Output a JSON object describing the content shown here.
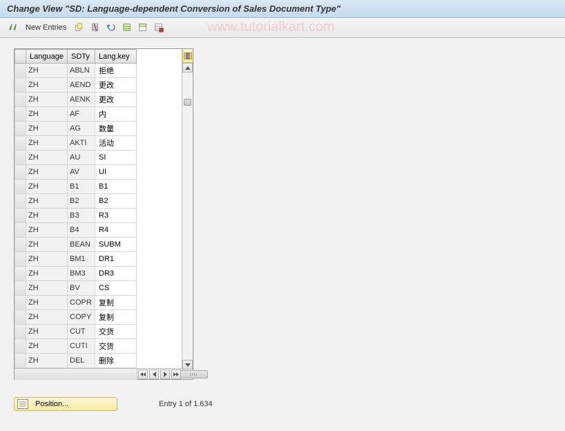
{
  "title": "Change View \"SD: Language-dependent Conversion of Sales Document Type\"",
  "watermark": "www.tutorialkart.com",
  "toolbar": {
    "new_entries": "New Entries"
  },
  "grid": {
    "headers": {
      "language": "Language",
      "sdty": "SDTy",
      "langkey": "Lang.key"
    },
    "rows": [
      {
        "lang": "ZH",
        "sdty": "ABLN",
        "langkey": "拒绝"
      },
      {
        "lang": "ZH",
        "sdty": "AEND",
        "langkey": "更改"
      },
      {
        "lang": "ZH",
        "sdty": "AENK",
        "langkey": "更改"
      },
      {
        "lang": "ZH",
        "sdty": "AF",
        "langkey": "内"
      },
      {
        "lang": "ZH",
        "sdty": "AG",
        "langkey": "数量"
      },
      {
        "lang": "ZH",
        "sdty": "AKTI",
        "langkey": "活动"
      },
      {
        "lang": "ZH",
        "sdty": "AU",
        "langkey": "SI"
      },
      {
        "lang": "ZH",
        "sdty": "AV",
        "langkey": "UI"
      },
      {
        "lang": "ZH",
        "sdty": "B1",
        "langkey": "B1"
      },
      {
        "lang": "ZH",
        "sdty": "B2",
        "langkey": "B2"
      },
      {
        "lang": "ZH",
        "sdty": "B3",
        "langkey": "R3"
      },
      {
        "lang": "ZH",
        "sdty": "B4",
        "langkey": "R4"
      },
      {
        "lang": "ZH",
        "sdty": "BEAN",
        "langkey": "SUBM"
      },
      {
        "lang": "ZH",
        "sdty": "BM1",
        "langkey": "DR1"
      },
      {
        "lang": "ZH",
        "sdty": "BM3",
        "langkey": "DR3"
      },
      {
        "lang": "ZH",
        "sdty": "BV",
        "langkey": "CS"
      },
      {
        "lang": "ZH",
        "sdty": "COPR",
        "langkey": "复制"
      },
      {
        "lang": "ZH",
        "sdty": "COPY",
        "langkey": "复制"
      },
      {
        "lang": "ZH",
        "sdty": "CUT",
        "langkey": "交货"
      },
      {
        "lang": "ZH",
        "sdty": "CUTI",
        "langkey": "交货"
      },
      {
        "lang": "ZH",
        "sdty": "DEL",
        "langkey": "删除"
      }
    ]
  },
  "footer": {
    "position_label": "Position...",
    "entry_info": "Entry 1 of 1.634"
  }
}
